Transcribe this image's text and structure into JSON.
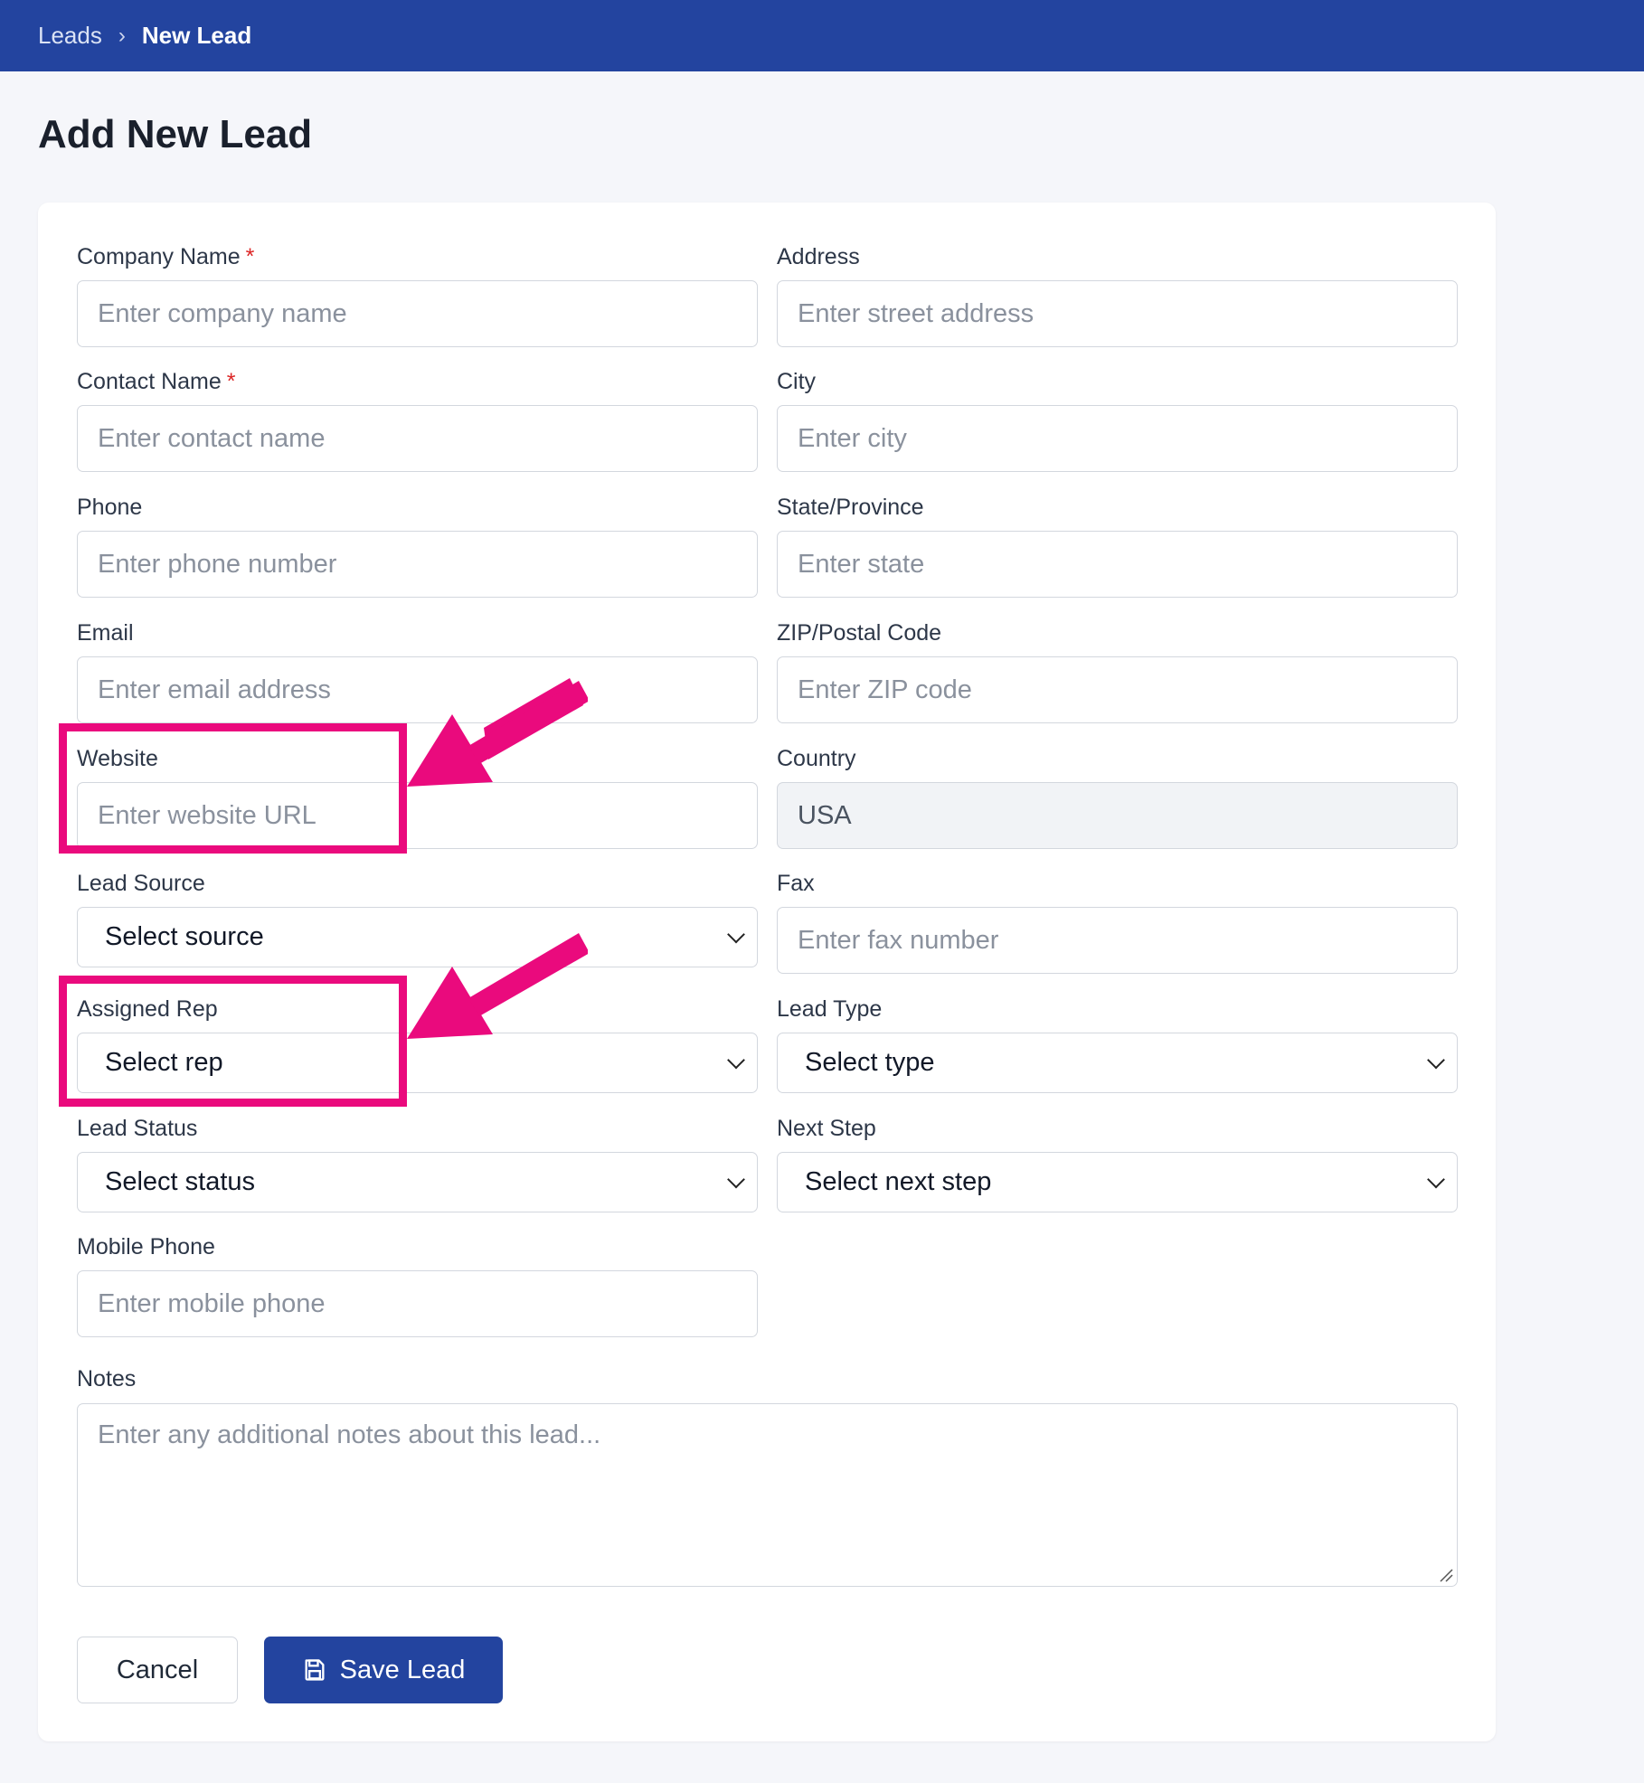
{
  "breadcrumb": {
    "parent": "Leads",
    "separator": "›",
    "current": "New Lead"
  },
  "page": {
    "title": "Add New Lead"
  },
  "form": {
    "company_name": {
      "label": "Company Name",
      "required_mark": "*",
      "placeholder": "Enter company name"
    },
    "contact_name": {
      "label": "Contact Name",
      "required_mark": "*",
      "placeholder": "Enter contact name"
    },
    "phone": {
      "label": "Phone",
      "placeholder": "Enter phone number"
    },
    "email": {
      "label": "Email",
      "placeholder": "Enter email address"
    },
    "website": {
      "label": "Website",
      "placeholder": "Enter website URL"
    },
    "lead_source": {
      "label": "Lead Source",
      "value": "Select source"
    },
    "assigned_rep": {
      "label": "Assigned Rep",
      "value": "Select rep"
    },
    "lead_status": {
      "label": "Lead Status",
      "value": "Select status"
    },
    "mobile_phone": {
      "label": "Mobile Phone",
      "placeholder": "Enter mobile phone"
    },
    "address": {
      "label": "Address",
      "placeholder": "Enter street address"
    },
    "city": {
      "label": "City",
      "placeholder": "Enter city"
    },
    "state": {
      "label": "State/Province",
      "placeholder": "Enter state"
    },
    "zip": {
      "label": "ZIP/Postal Code",
      "placeholder": "Enter ZIP code"
    },
    "country": {
      "label": "Country",
      "value": "USA"
    },
    "fax": {
      "label": "Fax",
      "placeholder": "Enter fax number"
    },
    "lead_type": {
      "label": "Lead Type",
      "value": "Select type"
    },
    "next_step": {
      "label": "Next Step",
      "value": "Select next step"
    },
    "notes": {
      "label": "Notes",
      "placeholder": "Enter any additional notes about this lead..."
    }
  },
  "actions": {
    "cancel": "Cancel",
    "save": "Save Lead"
  },
  "icons": {
    "save": "save-icon",
    "select_chevron": "chevron-down-icon",
    "annotation_arrow": "arrow-icon"
  },
  "colors": {
    "header": "#23449f",
    "primary_button": "#23449f",
    "annotation": "#ea0a7d",
    "required": "#dc2626"
  }
}
